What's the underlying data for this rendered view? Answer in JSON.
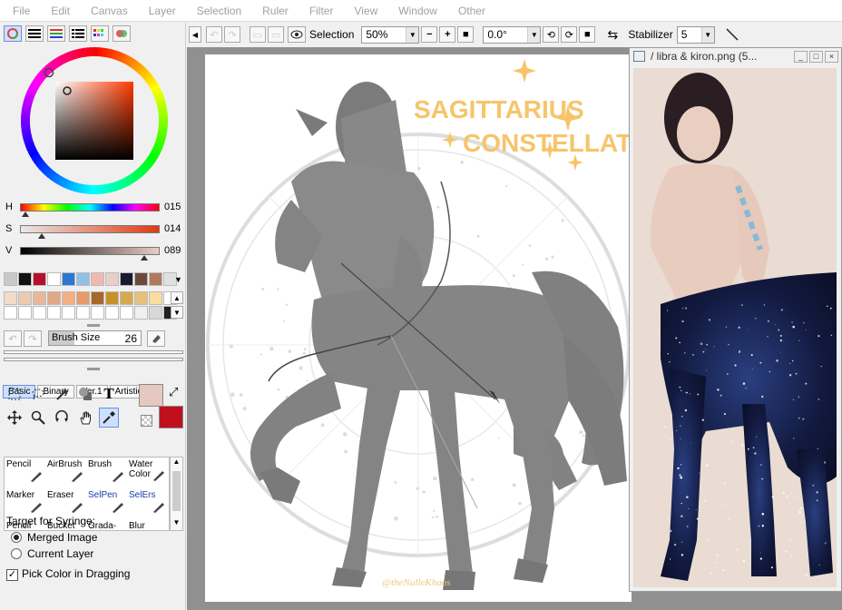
{
  "menu": [
    "File",
    "Edit",
    "Canvas",
    "Layer",
    "Selection",
    "Ruler",
    "Filter",
    "View",
    "Window",
    "Other"
  ],
  "color_panel": {
    "hsv": [
      {
        "label": "H",
        "value": "015"
      },
      {
        "label": "S",
        "value": "014"
      },
      {
        "label": "V",
        "value": "089"
      }
    ],
    "palette_row1": [
      "#c8c8c8",
      "#101010",
      "#b8102a",
      "#ffffff",
      "#2c76d4",
      "#8fc0e8",
      "#f2b8b0",
      "#e8d0c8",
      "#1a1a2e",
      "#6b4a3a",
      "#b07a5a",
      "#e0e0e0"
    ],
    "palette_row2": [
      "#f0dcc8",
      "#eccab0",
      "#e8b898",
      "#e0a888",
      "#f4b080",
      "#e89a6a",
      "#a8682a",
      "#c8902a",
      "#d8a850",
      "#e8c078",
      "#f8dca0",
      "#ffffff"
    ],
    "palette_row3": [
      "#ffffff",
      "#ffffff",
      "#ffffff",
      "#ffffff",
      "#ffffff",
      "#ffffff",
      "#ffffff",
      "#ffffff",
      "#ffffff",
      "#f0f0f0",
      "#d8d8d8",
      "#202020"
    ],
    "primary_color": "#e6c8c0",
    "secondary_color": "#c0101e"
  },
  "brush_size": {
    "label": "Brush Size",
    "value": "26"
  },
  "tool_tabs": [
    "Basic",
    "Binary",
    "Ver.1",
    "Artistic"
  ],
  "brushes": [
    [
      "Pencil",
      "AirBrush",
      "Brush",
      "Water Color"
    ],
    [
      "Marker",
      "Eraser",
      "SelPen",
      "SelErs"
    ],
    [
      "Pencil",
      "Bucket",
      "Grada-",
      "Blur"
    ]
  ],
  "syringe": {
    "heading": "Target for Syringe:",
    "options": [
      "Merged Image",
      "Current Layer"
    ],
    "selected": "Merged Image",
    "checkbox": "Pick Color in Dragging"
  },
  "toolbar": {
    "selection_label": "Selection",
    "zoom": "50%",
    "rotation": "0.0°",
    "stabilizer_label": "Stabilizer",
    "stabilizer_value": "5"
  },
  "canvas": {
    "title1": "SAGITTARIUS",
    "title2": "CONSTELLATION",
    "signature": "@theNulleKhaos"
  },
  "subwindow": {
    "title": "/ libra & kiron.png (5..."
  }
}
